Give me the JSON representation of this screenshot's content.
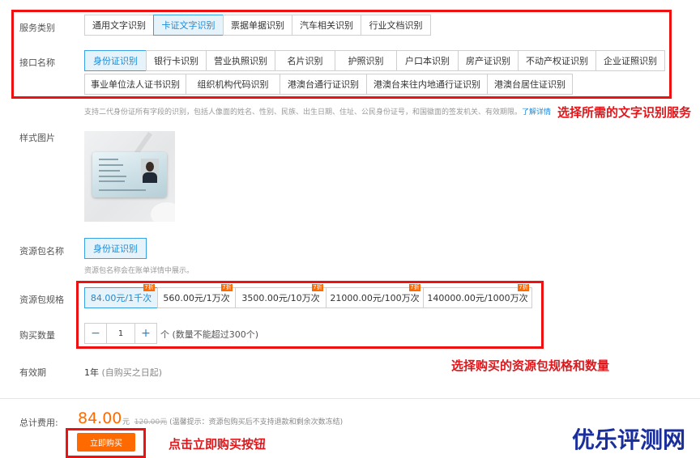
{
  "labels": {
    "service_type": "服务类别",
    "interface": "接口名称",
    "sample_image": "样式图片",
    "package_name": "资源包名称",
    "package_spec": "资源包规格",
    "quantity": "购买数量",
    "validity": "有效期",
    "total": "总计费用:"
  },
  "service_tabs": [
    "通用文字识别",
    "卡证文字识别",
    "票据单据识别",
    "汽车相关识别",
    "行业文档识别"
  ],
  "interfaces_row1": [
    "身份证识别",
    "银行卡识别",
    "营业执照识别",
    "名片识别",
    "护照识别",
    "户口本识别",
    "房产证识别",
    "不动产权证识别",
    "企业证照识别"
  ],
  "interfaces_row2": [
    "事业单位法人证书识别",
    "组织机构代码识别",
    "港澳台通行证识别",
    "港澳台来往内地通行证识别",
    "港澳台居住证识别"
  ],
  "interface_desc": "支持二代身份证所有字段的识别，包括人像面的姓名、性别、民族、出生日期、住址、公民身份证号，和国徽面的签发机关、有效期限。",
  "interface_desc_link": "了解详情",
  "package": {
    "name": "身份证识别",
    "hint": "资源包名称会在账单详情中展示。",
    "specs": [
      "84.00元/1千次",
      "560.00元/1万次",
      "3500.00元/10万次",
      "21000.00元/100万次",
      "140000.00元/1000万次"
    ],
    "discount": "7折"
  },
  "quantity": {
    "minus": "−",
    "plus": "+",
    "value": "1",
    "unit": "个",
    "limit": "(数量不能超过300个)"
  },
  "validity": {
    "value": "1年",
    "note": "(自购买之日起)"
  },
  "total": {
    "amount": "84.00",
    "currency": "元",
    "original": "120.00元",
    "notice": "(温馨提示：资源包购买后不支持退款和剩余次数冻结)"
  },
  "buy_button": "立即购买",
  "annotations": {
    "select_service": "选择所需的文字识别服务",
    "select_spec": "选择购买的资源包规格和数量",
    "click_buy": "点击立即购买按钮"
  },
  "watermark": "优乐评测网",
  "colors": {
    "accent": "#1c8ad6",
    "price": "#ff6a00",
    "annotation": "#e0161b",
    "watermark": "#1a2e9c"
  }
}
